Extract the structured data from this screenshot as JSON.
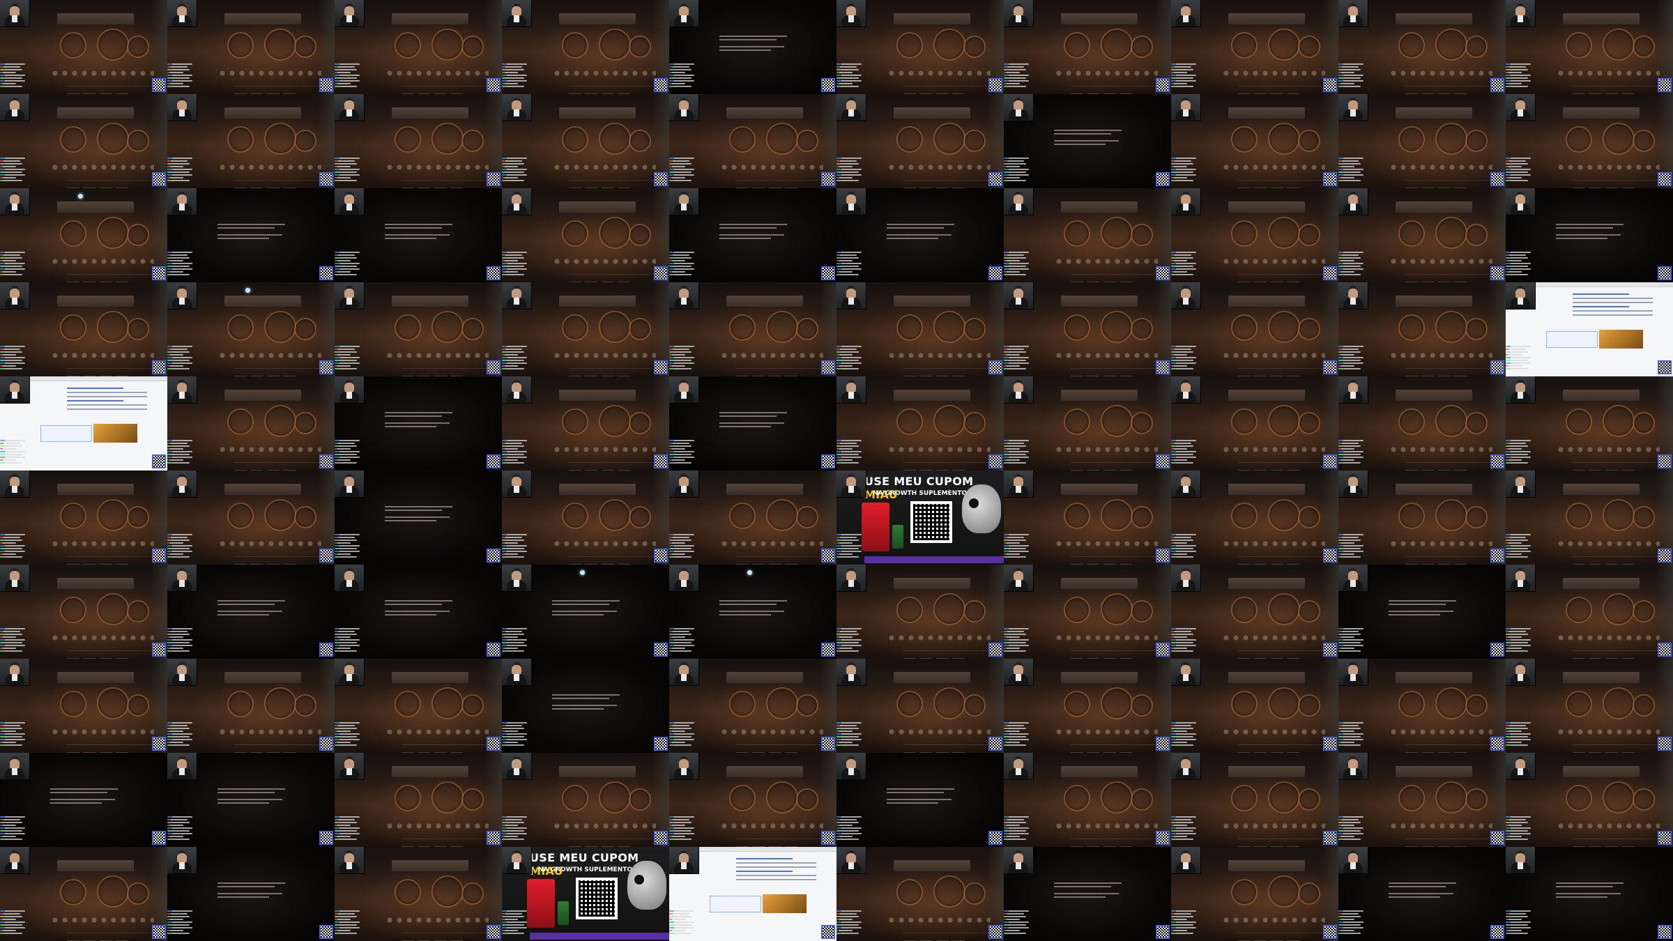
{
  "window": {
    "title": ""
  },
  "layout": {
    "rows": 10,
    "cols": 10
  },
  "colors": {
    "game_wood": "#3a2519",
    "dark_scene": "#060504",
    "qr_widget": "#4f5fd4",
    "ad_gold": "#f3c21b",
    "ad_purple": "#5a2fa0",
    "browser_bg": "#f5f6f8"
  },
  "tile_types": {
    "G": "game-puzzle-box-scene",
    "D": "dark-narration-scene",
    "W": "browser-page",
    "A": "sponsor-ad"
  },
  "tile_pattern": [
    "GGGGDGGGGG",
    "GGGGGGDGGG",
    "GDDGDDGGGD",
    "GGGGGGGGGW",
    "WGDGDGGGGG",
    "GGDGGAGGGG",
    "GDDDDGGGDG",
    "GGGDGGGGGG",
    "DDGGGDGGGG",
    "GDGAWGDGDD"
  ],
  "ad": {
    "line1_prefix": "USE MEU CUPOM",
    "line1_code": "MIAU",
    "line2": "NA GROWTH SUPLEMENTOS",
    "icons": [
      "supplement-product-icon",
      "qr-code-icon",
      "skull-mascot-icon"
    ]
  },
  "overlay": {
    "webcam": "webcam-feed",
    "chat": "chat-overlay",
    "qr": "qr-code-icon"
  }
}
